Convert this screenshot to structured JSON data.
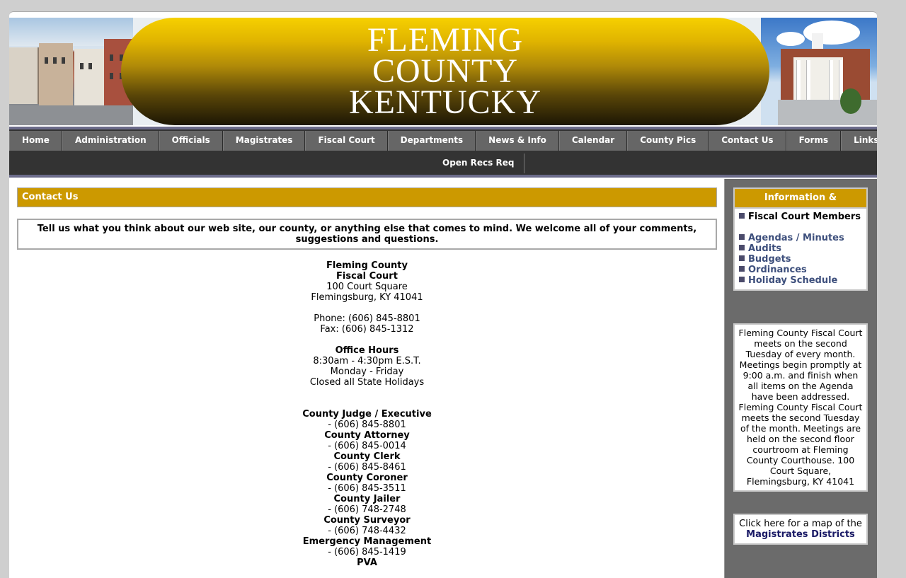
{
  "banner": {
    "title_lines": [
      "FLEMING",
      "COUNTY",
      "KENTUCKY"
    ]
  },
  "nav": {
    "items": [
      "Home",
      "Administration",
      "Officials",
      "Magistrates",
      "Fiscal Court",
      "Departments",
      "News & Info",
      "Calendar",
      "County Pics",
      "Contact Us",
      "Forms",
      "Links"
    ],
    "row2": [
      "Open Recs Req"
    ]
  },
  "main": {
    "section_title": "Contact Us",
    "intro": "Tell us what you think about our web site, our county, or anything else that comes to mind. We welcome all of your comments, suggestions and questions.",
    "org": {
      "name1": "Fleming County",
      "name2": "Fiscal Court",
      "address1": "100 Court Square",
      "address2": "Flemingsburg, KY 41041",
      "phone": "Phone: (606) 845-8801",
      "fax": "Fax: (606) 845-1312"
    },
    "hours": {
      "title": "Office Hours",
      "time": "8:30am - 4:30pm E.S.T.",
      "days": "Monday - Friday",
      "note": "Closed all State Holidays"
    },
    "offices": [
      {
        "name": "County Judge / Executive",
        "phone": "- (606) 845-8801"
      },
      {
        "name": "County Attorney",
        "phone": "- (606) 845-0014"
      },
      {
        "name": "County Clerk",
        "phone": "- (606) 845-8461"
      },
      {
        "name": "County Coroner",
        "phone": "- (606) 845-3511"
      },
      {
        "name": "County Jailer",
        "phone": "- (606) 748-2748"
      },
      {
        "name": "County Surveyor",
        "phone": "- (606) 748-4432"
      },
      {
        "name": "Emergency Management",
        "phone": "- (606) 845-1419"
      },
      {
        "name": "PVA",
        "phone": ""
      }
    ]
  },
  "sidebar": {
    "docs_title": "Information & Documents",
    "fiscal_members": "Fiscal Court Members",
    "docs": [
      "Agendas / Minutes",
      "Audits",
      "Budgets",
      "Ordinances",
      "Holiday Schedule"
    ],
    "meeting_text": "Fleming County Fiscal Court meets on the second Tuesday of every month. Meetings begin promptly at 9:00 a.m. and finish when all items on the Agenda have been addressed. Fleming County Fiscal Court meets the second Tuesday of the month. Meetings are held on the second floor courtroom at Fleming County Courthouse. 100 Court Square, Flemingsburg, KY 41041",
    "map_text": "Click here for a map of the",
    "map_link": "Magistrates Districts"
  }
}
